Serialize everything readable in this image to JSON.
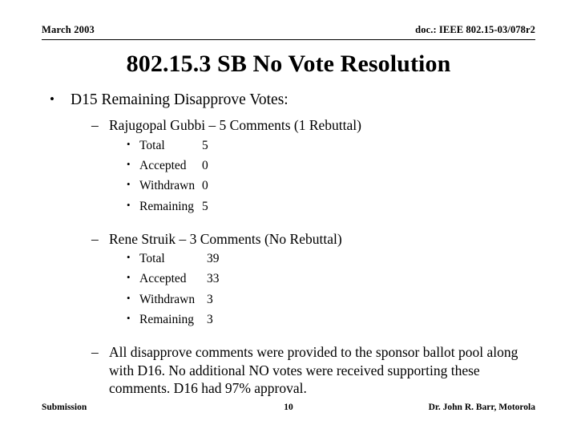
{
  "header": {
    "left": "March 2003",
    "right": "doc.: IEEE 802.15-03/078r2"
  },
  "title": "802.15.3 SB No Vote Resolution",
  "body": {
    "level1": "D15 Remaining Disapprove Votes:",
    "bullet_level1": "•",
    "bullet_level2": "–",
    "bullet_level3": "•",
    "groups": [
      {
        "heading": "Rajugopal Gubbi – 5 Comments (1 Rebuttal)",
        "rows": [
          {
            "label": "Total",
            "value": "5"
          },
          {
            "label": "Accepted",
            "value": "0"
          },
          {
            "label": "Withdrawn",
            "value": "0"
          },
          {
            "label": "Remaining",
            "value": "5"
          }
        ]
      },
      {
        "heading": "Rene Struik – 3 Comments (No Rebuttal)",
        "rows": [
          {
            "label": "Total",
            "value": "39"
          },
          {
            "label": "Accepted",
            "value": "33"
          },
          {
            "label": "Withdrawn",
            "value": "3"
          },
          {
            "label": "Remaining",
            "value": "3"
          }
        ]
      }
    ],
    "closing": "All disapprove comments were provided to the sponsor ballot pool along with D16. No additional NO votes were received supporting these comments. D16 had 97% approval."
  },
  "footer": {
    "left": "Submission",
    "center": "10",
    "right": "Dr. John R. Barr, Motorola"
  }
}
